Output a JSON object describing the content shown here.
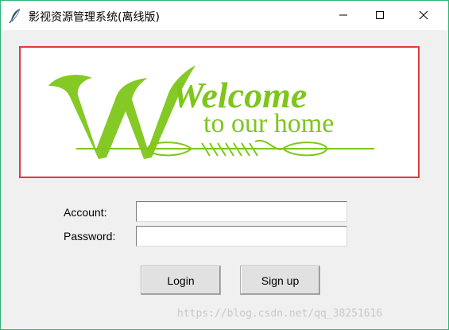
{
  "window": {
    "title": "影视资源管理系统(离线版)",
    "border_color": "#2fb574"
  },
  "banner": {
    "text_line1": "Welcome",
    "text_line2": "to our home",
    "text_color": "#7ec61a",
    "border_color": "#e0393e"
  },
  "form": {
    "account_label": "Account:",
    "account_value": "",
    "password_label": "Password:",
    "password_value": ""
  },
  "buttons": {
    "login_label": "Login",
    "signup_label": "Sign up"
  },
  "watermark": "https://blog.csdn.net/qq_38251616",
  "icons": {
    "app": "feather-icon",
    "minimize": "minimize-icon",
    "maximize": "maximize-icon",
    "close": "close-icon"
  }
}
